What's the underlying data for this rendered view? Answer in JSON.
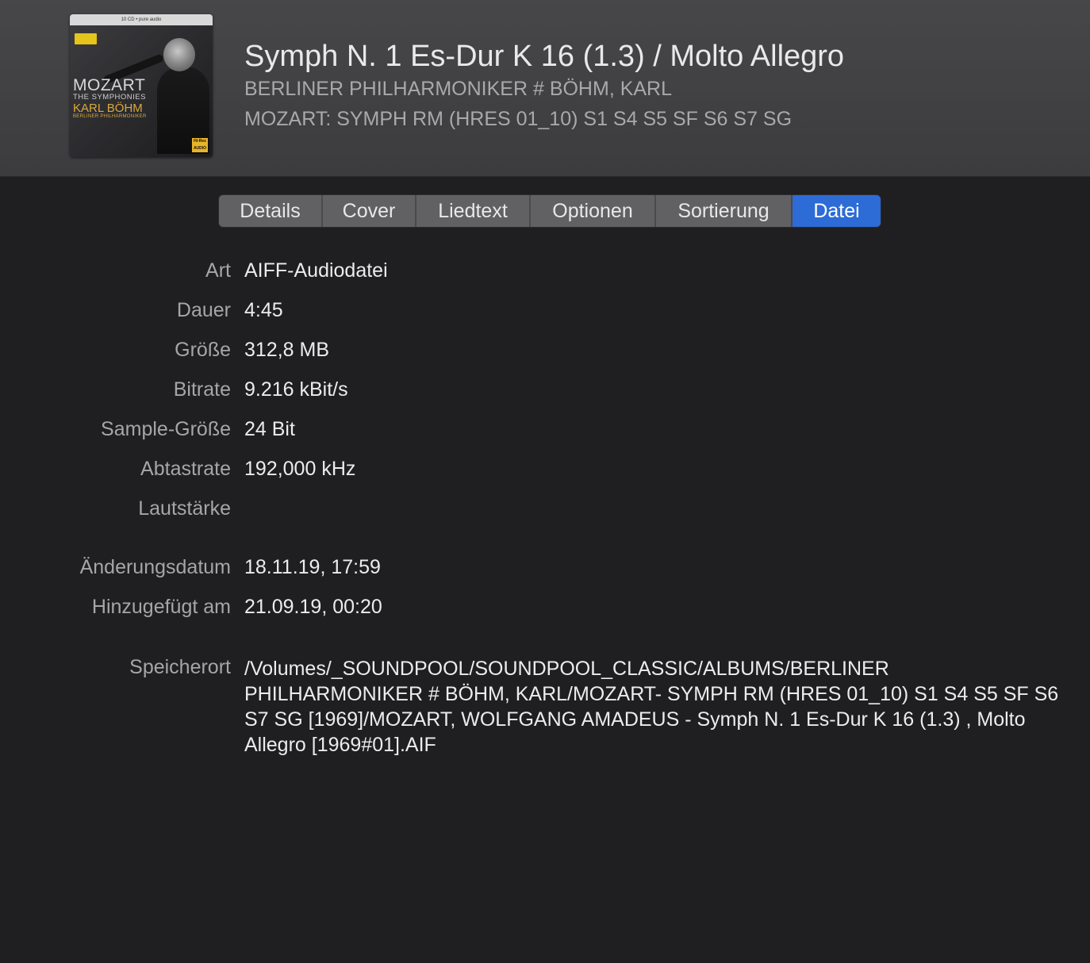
{
  "header": {
    "title": "Symph N. 1 Es-Dur K 16 (1.3) / Molto Allegro",
    "artist": "BERLINER PHILHARMONIKER # BÖHM, KARL",
    "album": "MOZART: SYMPH RM (HRES 01_10) S1 S4 S5 SF S6 S7 SG",
    "artwork": {
      "line1": "MOZART",
      "line2": "THE SYMPHONIES",
      "line3": "KARL BÖHM",
      "line4": "BERLINER PHILHARMONIKER",
      "topbar": "10 CD • pure audio",
      "badge": "Hi-Res AUDIO"
    }
  },
  "tabs": [
    {
      "label": "Details",
      "active": false
    },
    {
      "label": "Cover",
      "active": false
    },
    {
      "label": "Liedtext",
      "active": false
    },
    {
      "label": "Optionen",
      "active": false
    },
    {
      "label": "Sortierung",
      "active": false
    },
    {
      "label": "Datei",
      "active": true
    }
  ],
  "fields": {
    "art": {
      "label": "Art",
      "value": "AIFF-Audiodatei"
    },
    "dauer": {
      "label": "Dauer",
      "value": "4:45"
    },
    "groesse": {
      "label": "Größe",
      "value": "312,8 MB"
    },
    "bitrate": {
      "label": "Bitrate",
      "value": "9.216 kBit/s"
    },
    "sample": {
      "label": "Sample-Größe",
      "value": "24 Bit"
    },
    "abtastrate": {
      "label": "Abtastrate",
      "value": "192,000 kHz"
    },
    "lautstaerke": {
      "label": "Lautstärke",
      "value": ""
    },
    "aenderung": {
      "label": "Änderungsdatum",
      "value": "18.11.19, 17:59"
    },
    "hinzugefuegt": {
      "label": "Hinzugefügt am",
      "value": "21.09.19, 00:20"
    },
    "speicherort": {
      "label": "Speicherort",
      "value": "/Volumes/_SOUNDPOOL/SOUNDPOOL_CLASSIC/ALBUMS/BERLINER PHILHARMONIKER # BÖHM, KARL/MOZART- SYMPH RM (HRES 01_10) S1 S4 S5 SF S6 S7 SG [1969]/MOZART, WOLFGANG AMADEUS - Symph N. 1 Es-Dur K 16 (1.3) , Molto Allegro [1969#01].AIF"
    }
  },
  "colors": {
    "accent": "#2d6bd6",
    "background": "#1f1f21",
    "header": "#434345"
  }
}
